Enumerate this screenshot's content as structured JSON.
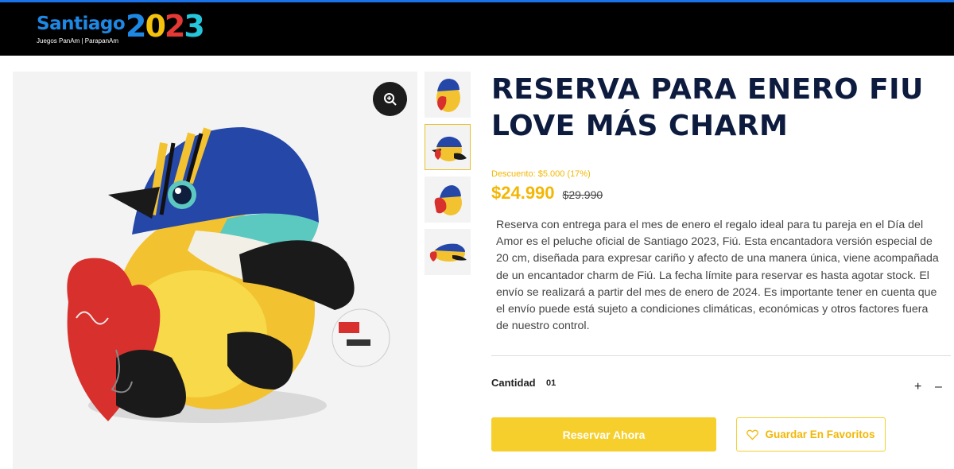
{
  "header": {
    "logo_word": "Santiago",
    "logo_year_digits": [
      "2",
      "0",
      "2",
      "3"
    ],
    "logo_subtitle": "Juegos PanAm | ParapanAm",
    "accent_color": "#1a73e8"
  },
  "gallery": {
    "zoom_icon": "zoom-in-icon",
    "thumbnail_count": 4,
    "active_thumbnail": 2
  },
  "product": {
    "title": "RESERVA PARA ENERO FIU LOVE MÁS CHARM",
    "discount": "Descuento: $5.000 (17%)",
    "price": "$24.990",
    "old_price": "$29.990",
    "description": "Reserva con entrega para el mes de enero el regalo ideal para tu pareja en el Día del Amor es el peluche oficial de Santiago 2023, Fiú. Esta encantadora versión especial de 20 cm, diseñada para expresar cariño y afecto de una manera única, viene acompañada de un encantador charm de Fiú. La fecha límite para reservar es hasta agotar stock. El envío se realizará a partir del mes de enero de 2024. Es importante tener en cuenta que el envío puede está sujeto a condiciones climáticas, económicas y otros factores fuera de nuestro control."
  },
  "quantity": {
    "label": "Cantidad",
    "value": "01",
    "plus": "+",
    "minus": "–"
  },
  "actions": {
    "reserve_label": "Reservar Ahora",
    "favorite_label": "Guardar En Favoritos",
    "favorite_icon": "heart-icon"
  },
  "colors": {
    "brand_yellow": "#f6cf2d",
    "price_yellow": "#f2b705",
    "title_navy": "#0d1b3e"
  }
}
